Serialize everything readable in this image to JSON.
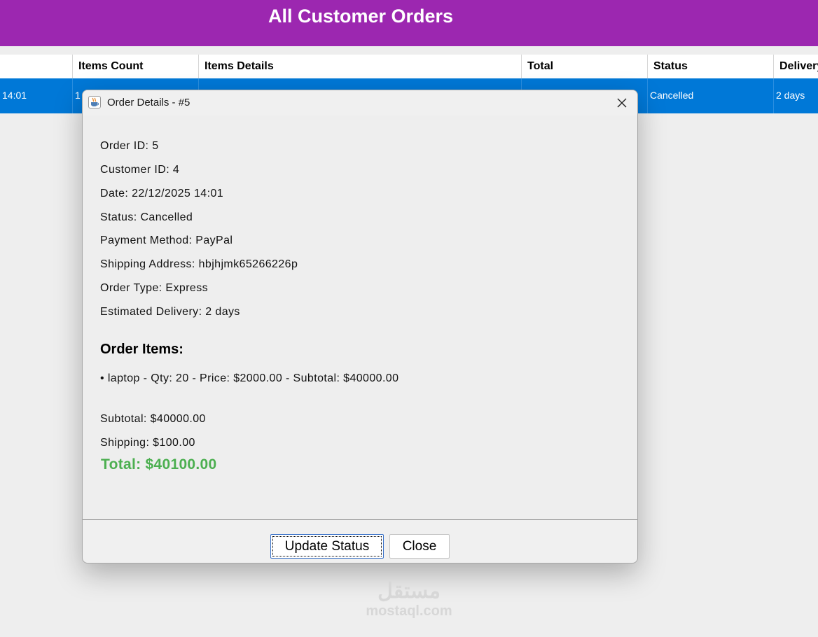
{
  "header": {
    "title": "All Customer Orders"
  },
  "table": {
    "columns": [
      "",
      "Items Count",
      "Items Details",
      "Total",
      "Status",
      "Delivery"
    ],
    "row": [
      "14:01",
      "1",
      "",
      "",
      "Cancelled",
      "2 days"
    ]
  },
  "dialog": {
    "title": "Order Details - #5",
    "icon": "java-cup-icon",
    "details": {
      "order_id": "Order ID: 5",
      "customer_id": "Customer ID: 4",
      "date": "Date: 22/12/2025 14:01",
      "status": "Status: Cancelled",
      "payment": "Payment Method: PayPal",
      "shipping_address": "Shipping Address: hbjhjmk65266226p",
      "order_type": "Order Type: Express",
      "delivery": "Estimated Delivery: 2 days"
    },
    "items_heading": "Order Items:",
    "items": [
      "• laptop - Qty: 20 - Price: $2000.00 - Subtotal: $40000.00"
    ],
    "subtotal": "Subtotal: $40000.00",
    "shipping": "Shipping: $100.00",
    "total": "Total: $40100.00",
    "buttons": {
      "update": "Update Status",
      "close": "Close"
    }
  },
  "watermark": {
    "logo": "مستقل",
    "text": "mostaql.com"
  },
  "colors": {
    "header_bg": "#9c27b0",
    "selected_row": "#0078d7",
    "total_green": "#4caf50"
  }
}
